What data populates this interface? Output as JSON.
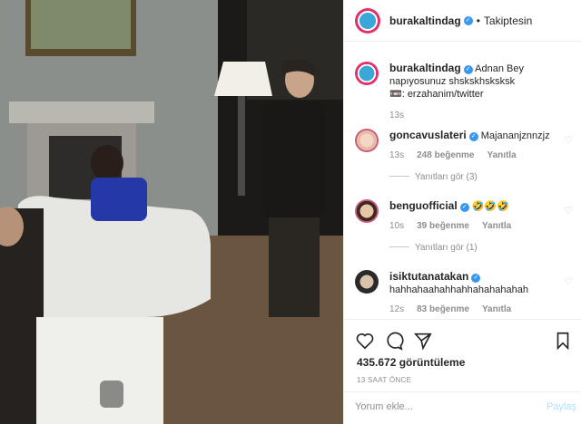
{
  "header": {
    "username": "burakaltindag",
    "separator": "•",
    "follow_status": "Takiptesin"
  },
  "caption": {
    "username": "burakaltindag",
    "text": "Adnan Bey napıyosunuz shskskhsksksk",
    "source": ": erzahanim/twitter",
    "time": "13s"
  },
  "comments": [
    {
      "username": "goncavuslateri",
      "text": "Majananjznnzjz",
      "time": "13s",
      "likes": "248 beğenme",
      "reply": "Yanıtla",
      "view_replies": "Yanıtları gör (3)"
    },
    {
      "username": "benguofficial",
      "text": "🤣🤣🤣",
      "time": "10s",
      "likes": "39 beğenme",
      "reply": "Yanıtla",
      "view_replies": "Yanıtları gör (1)"
    },
    {
      "username": "isiktutanatakan",
      "text": "hahhahaahahhahhahahahahah",
      "time": "12s",
      "likes": "83 beğenme",
      "reply": "Yanıtla"
    }
  ],
  "stats": {
    "views": "435.672 görüntüleme",
    "posted": "13 SAAT ÖNCE"
  },
  "comment_box": {
    "placeholder": "Yorum ekle...",
    "post_label": "Paylaş"
  },
  "colors": {
    "verified": "#3897f0",
    "link_disabled": "#b2dffc",
    "muted": "#8e8e8e"
  }
}
